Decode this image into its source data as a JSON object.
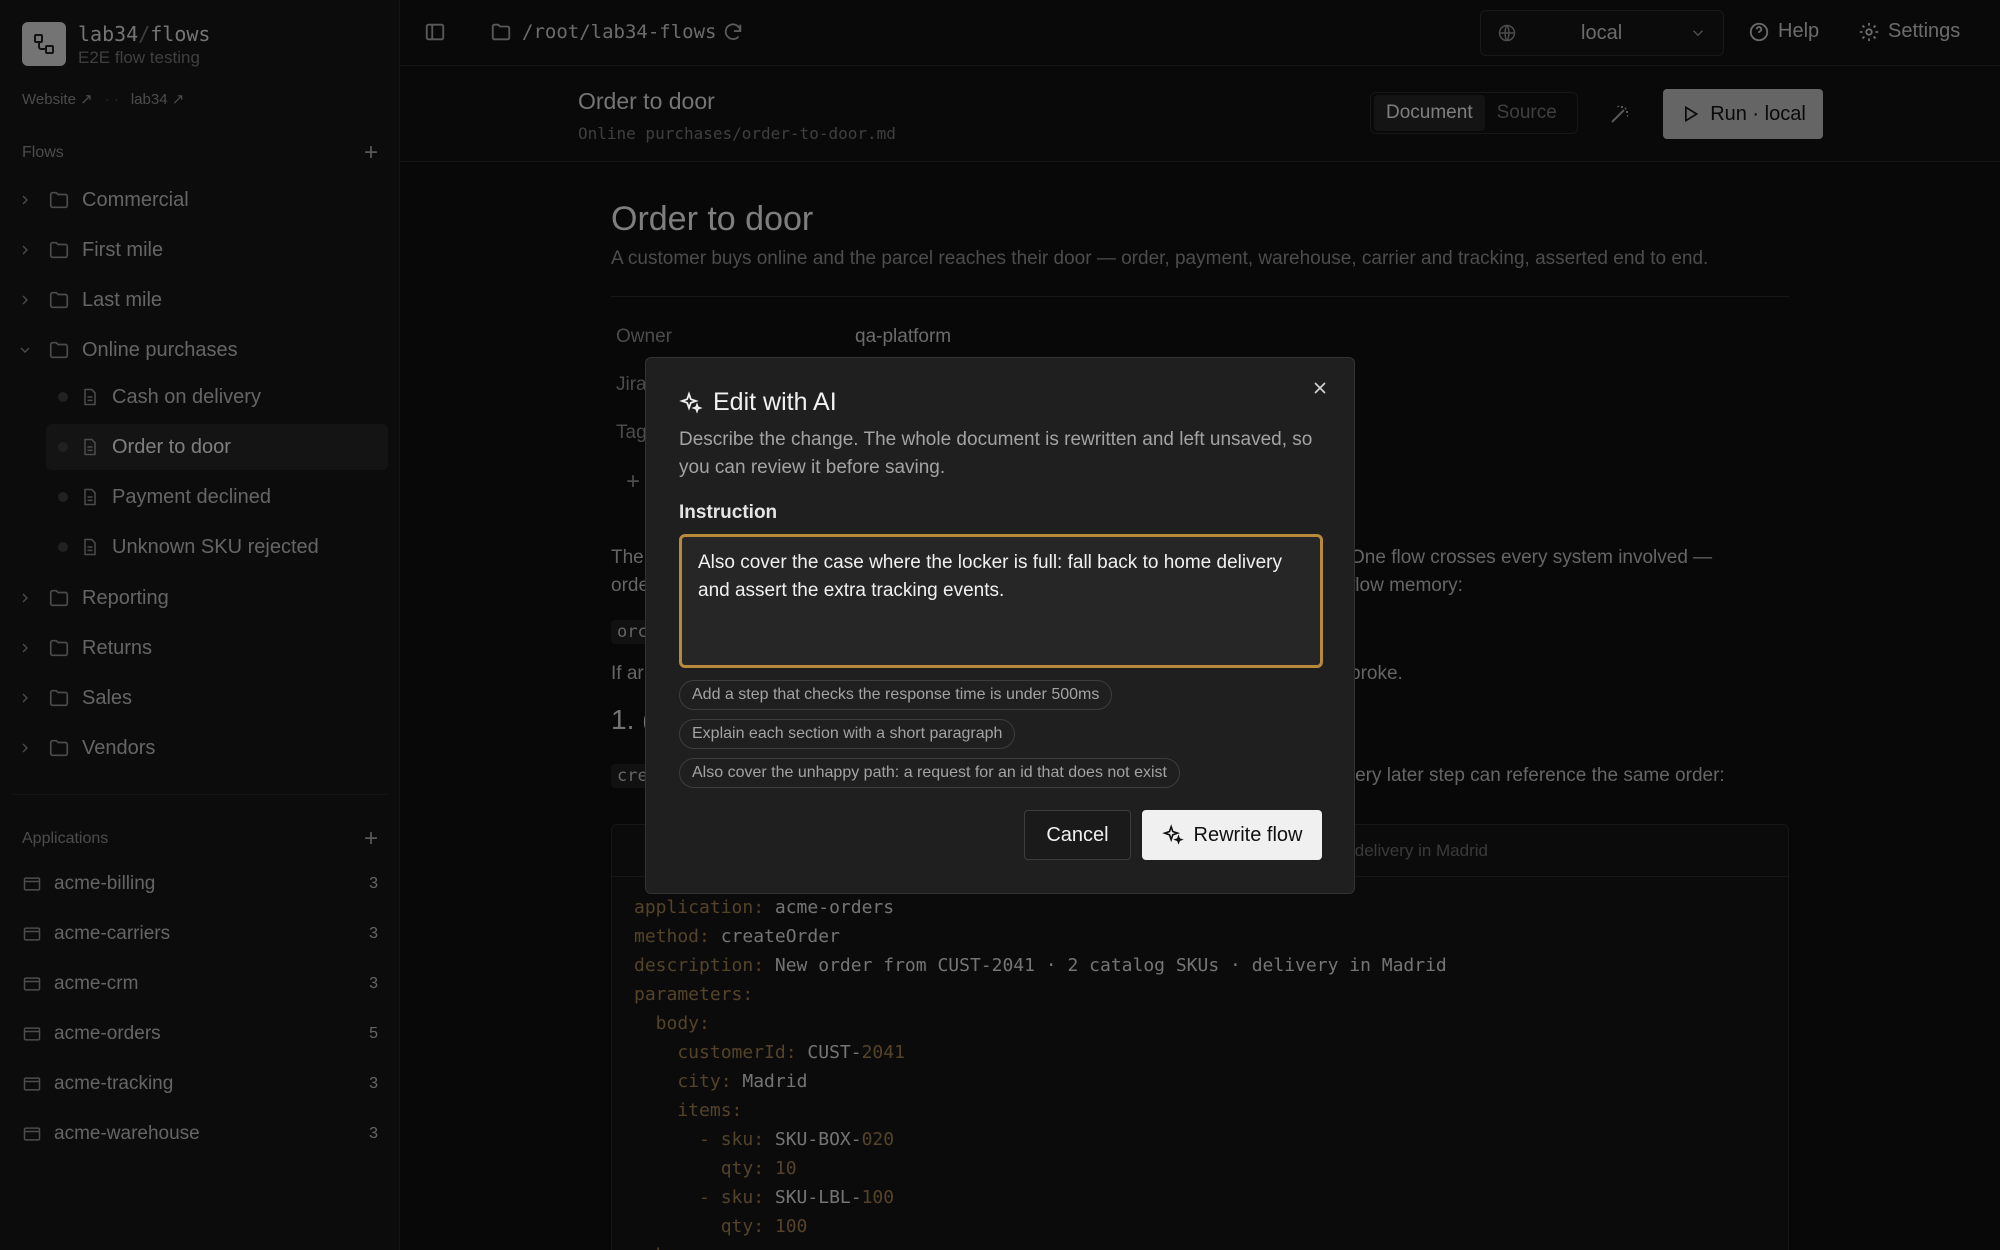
{
  "brand": {
    "name": "lab34",
    "sep": "/",
    "product": "flows",
    "subtitle": "E2E flow testing"
  },
  "links": {
    "website": "Website ↗",
    "lab34": "lab34 ↗",
    "dots": "·  ·"
  },
  "sidebar": {
    "flows_title": "Flows",
    "folders_top": [
      "Commercial",
      "First mile",
      "Last mile"
    ],
    "open_folder": "Online purchases",
    "files": [
      "Cash on delivery",
      "Order to door",
      "Payment declined",
      "Unknown SKU rejected"
    ],
    "folders_bottom": [
      "Reporting",
      "Returns",
      "Sales",
      "Vendors"
    ],
    "apps_title": "Applications",
    "apps": [
      {
        "name": "acme-billing",
        "count": "3"
      },
      {
        "name": "acme-carriers",
        "count": "3"
      },
      {
        "name": "acme-crm",
        "count": "3"
      },
      {
        "name": "acme-orders",
        "count": "5"
      },
      {
        "name": "acme-tracking",
        "count": "3"
      },
      {
        "name": "acme-warehouse",
        "count": "3"
      }
    ]
  },
  "topbar": {
    "path": "/root/lab34-flows",
    "env": "local",
    "help": "Help",
    "settings": "Settings"
  },
  "doc": {
    "title": "Order to door",
    "path": "Online purchases/order-to-door.md",
    "tab_document": "Document",
    "tab_source": "Source",
    "run": "Run · local"
  },
  "content": {
    "h1": "Order to door",
    "lead": "A customer buys online and the parcel reaches their door — order, payment, warehouse, carrier and tracking, asserted end to end.",
    "meta_owner_label": "Owner",
    "meta_owner_value": "qa-platform",
    "meta_jira": "Jira",
    "meta_tags": "Tag",
    "meta_add": "+",
    "p1_left": "The",
    "p1_left2": "orde",
    "p1_right": "One flow crosses every system involved —",
    "p1_right2": "flow memory:",
    "code1": "orc",
    "p2_left": "If ar",
    "p2_right": "broke.",
    "h2_left": "1. (",
    "code2": "cre",
    "p3_right": "every later step can reference the same order:",
    "codeblock_head": "delivery in Madrid",
    "code_lines": [
      {
        "k": "application:",
        "v": " acme-orders"
      },
      {
        "k": "method:",
        "v": " createOrder"
      },
      {
        "k": "description:",
        "v": " New order from CUST-2041 · 2 catalog SKUs · delivery in Madrid"
      },
      {
        "k": "parameters:",
        "v": ""
      },
      {
        "k": "  body:",
        "v": ""
      },
      {
        "k": "    customerId:",
        "v": " CUST-",
        "n": "2041"
      },
      {
        "k": "    city:",
        "v": " Madrid"
      },
      {
        "k": "    items:",
        "v": ""
      },
      {
        "k": "      - sku:",
        "v": " SKU-BOX-",
        "n": "020"
      },
      {
        "k": "        qty:",
        "v": "",
        "n": " 10"
      },
      {
        "k": "      - sku:",
        "v": " SKU-LBL-",
        "n": "100"
      },
      {
        "k": "        qty:",
        "v": "",
        "n": " 100"
      },
      {
        "k": "  h",
        "v": ""
      }
    ]
  },
  "modal": {
    "title": "Edit with AI",
    "description": "Describe the change. The whole document is rewritten and left unsaved, so you can review it before saving.",
    "label": "Instruction",
    "value": "Also cover the case where the locker is full: fall back to home delivery and assert the extra tracking events.",
    "suggestions": [
      "Add a step that checks the response time is under 500ms",
      "Explain each section with a short paragraph",
      "Also cover the unhappy path: a request for an id that does not exist"
    ],
    "cancel": "Cancel",
    "rewrite": "Rewrite flow"
  }
}
